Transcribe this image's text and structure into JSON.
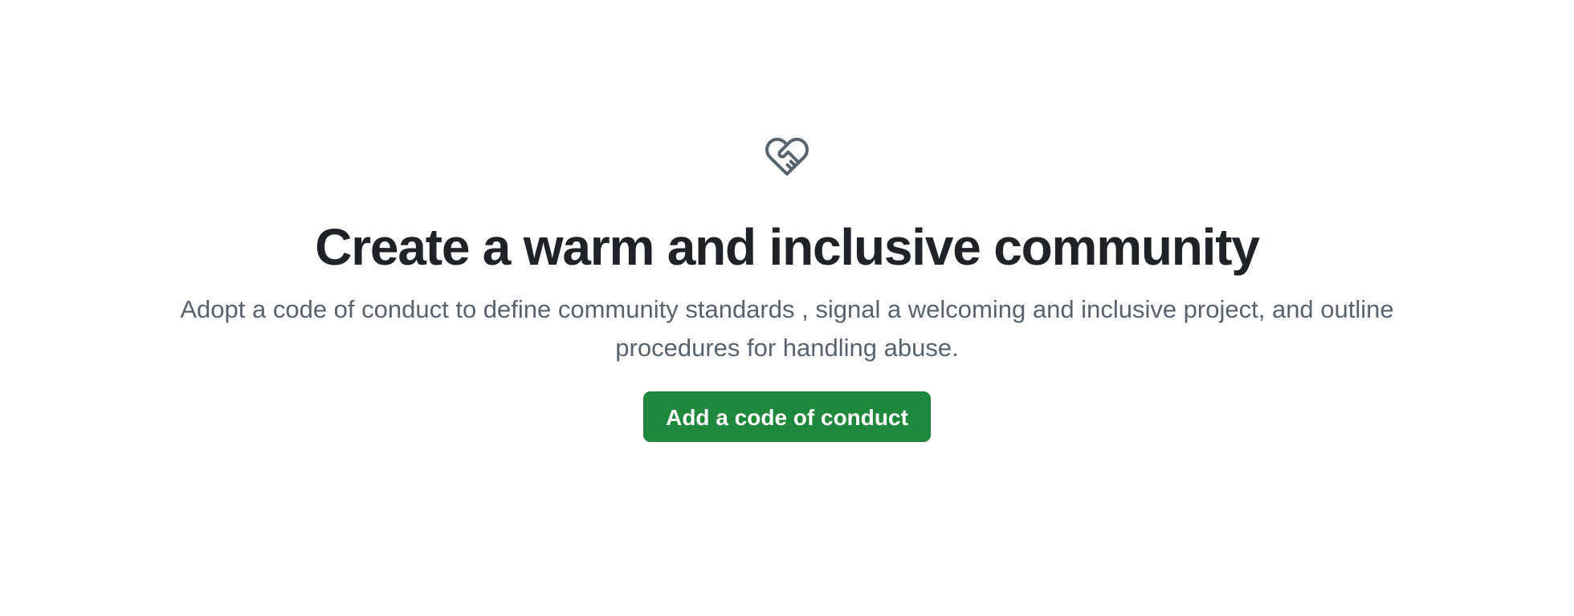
{
  "blankslate": {
    "icon": "heart-handshake-icon",
    "title": "Create a warm and inclusive community",
    "description": "Adopt a code of conduct to define community standards , signal a welcoming and inclusive project, and outline procedures for handling abuse.",
    "button_label": "Add a code of conduct"
  },
  "colors": {
    "title": "#1f2328",
    "description": "#59636e",
    "icon": "#59636e",
    "button_bg": "#1f883d",
    "button_text": "#ffffff"
  }
}
